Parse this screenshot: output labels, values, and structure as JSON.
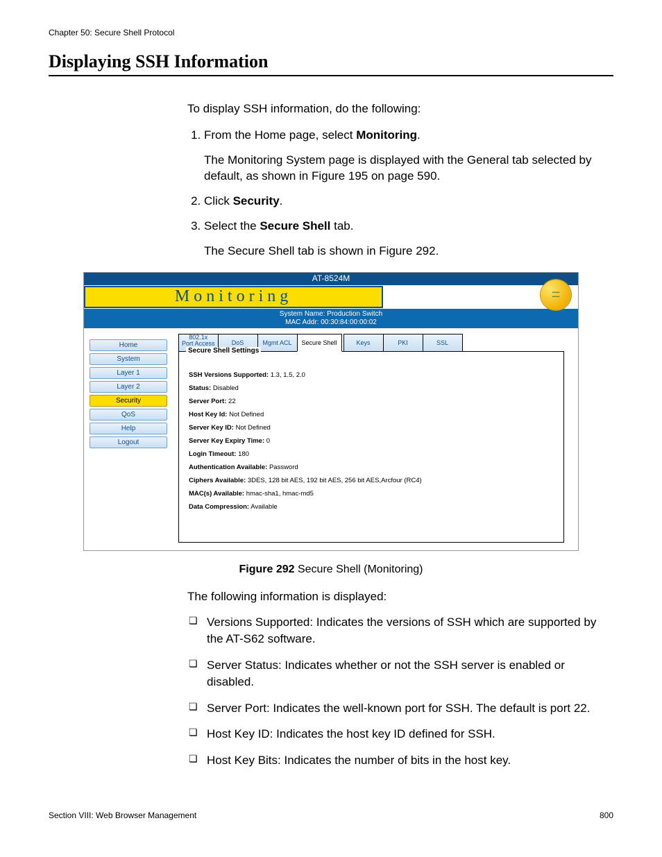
{
  "chapter": "Chapter 50: Secure Shell Protocol",
  "heading": "Displaying SSH Information",
  "intro": "To display SSH information, do the following:",
  "step1_pre": "From the Home page, select ",
  "step1_bold": "Monitoring",
  "step1_post": ".",
  "step1_note": "The Monitoring System page is displayed with the General tab selected by default, as shown in Figure 195 on page 590.",
  "step2_pre": "Click ",
  "step2_bold": "Security",
  "step2_post": ".",
  "step3_pre": "Select the ",
  "step3_bold": "Secure Shell",
  "step3_post": " tab.",
  "step3_note": "The Secure Shell tab is shown in Figure 292.",
  "figure_caption_bold": "Figure 292",
  "figure_caption_rest": "  Secure Shell (Monitoring)",
  "followup": "The following information is displayed:",
  "bullets": [
    "Versions Supported: Indicates the versions of SSH which are supported by the AT-S62 software.",
    "Server Status: Indicates whether or not the SSH server is enabled or disabled.",
    "Server Port: Indicates the well-known port for SSH. The default is port 22.",
    "Host Key ID: Indicates the host key ID defined for SSH.",
    "Host Key Bits: Indicates the number of bits in the host key."
  ],
  "footer_section": "Section VIII: Web Browser Management",
  "footer_page": "800",
  "screenshot": {
    "device_model": "AT-8524M",
    "title": "Monitoring",
    "sys_name": "System Name: Production Switch",
    "mac": "MAC Addr: 00:30:84:00:00:02",
    "sidebar": [
      "Home",
      "System",
      "Layer 1",
      "Layer 2",
      "Security",
      "QoS",
      "Help",
      "Logout"
    ],
    "sidebar_active": "Security",
    "tabs": [
      {
        "label": "802.1x\nPort Access",
        "twoLine": true
      },
      {
        "label": "DoS"
      },
      {
        "label": "Mgmt ACL"
      },
      {
        "label": "Secure Shell",
        "active": true
      },
      {
        "label": "Keys",
        "group2": true
      },
      {
        "label": "PKI",
        "group2": true
      },
      {
        "label": "SSL",
        "group2": true
      }
    ],
    "panel_title": "Secure Shell Settings",
    "settings": [
      {
        "label": "SSH Versions Supported:",
        "value": "1.3, 1.5, 2.0"
      },
      {
        "label": "Status:",
        "value": "Disabled"
      },
      {
        "label": "Server Port:",
        "value": "22"
      },
      {
        "label": "Host Key Id:",
        "value": "Not Defined"
      },
      {
        "label": "Server Key ID:",
        "value": "Not Defined"
      },
      {
        "label": "Server Key Expiry Time:",
        "value": "0"
      },
      {
        "label": "Login Timeout:",
        "value": "180"
      },
      {
        "label": "Authentication Available:",
        "value": "Password"
      },
      {
        "label": "Ciphers Available:",
        "value": "3DES, 128 bit AES, 192 bit AES, 256 bit AES,Arcfour (RC4)"
      },
      {
        "label": "MAC(s) Available:",
        "value": "hmac-sha1, hmac-md5"
      },
      {
        "label": "Data Compression:",
        "value": "Available"
      }
    ]
  }
}
